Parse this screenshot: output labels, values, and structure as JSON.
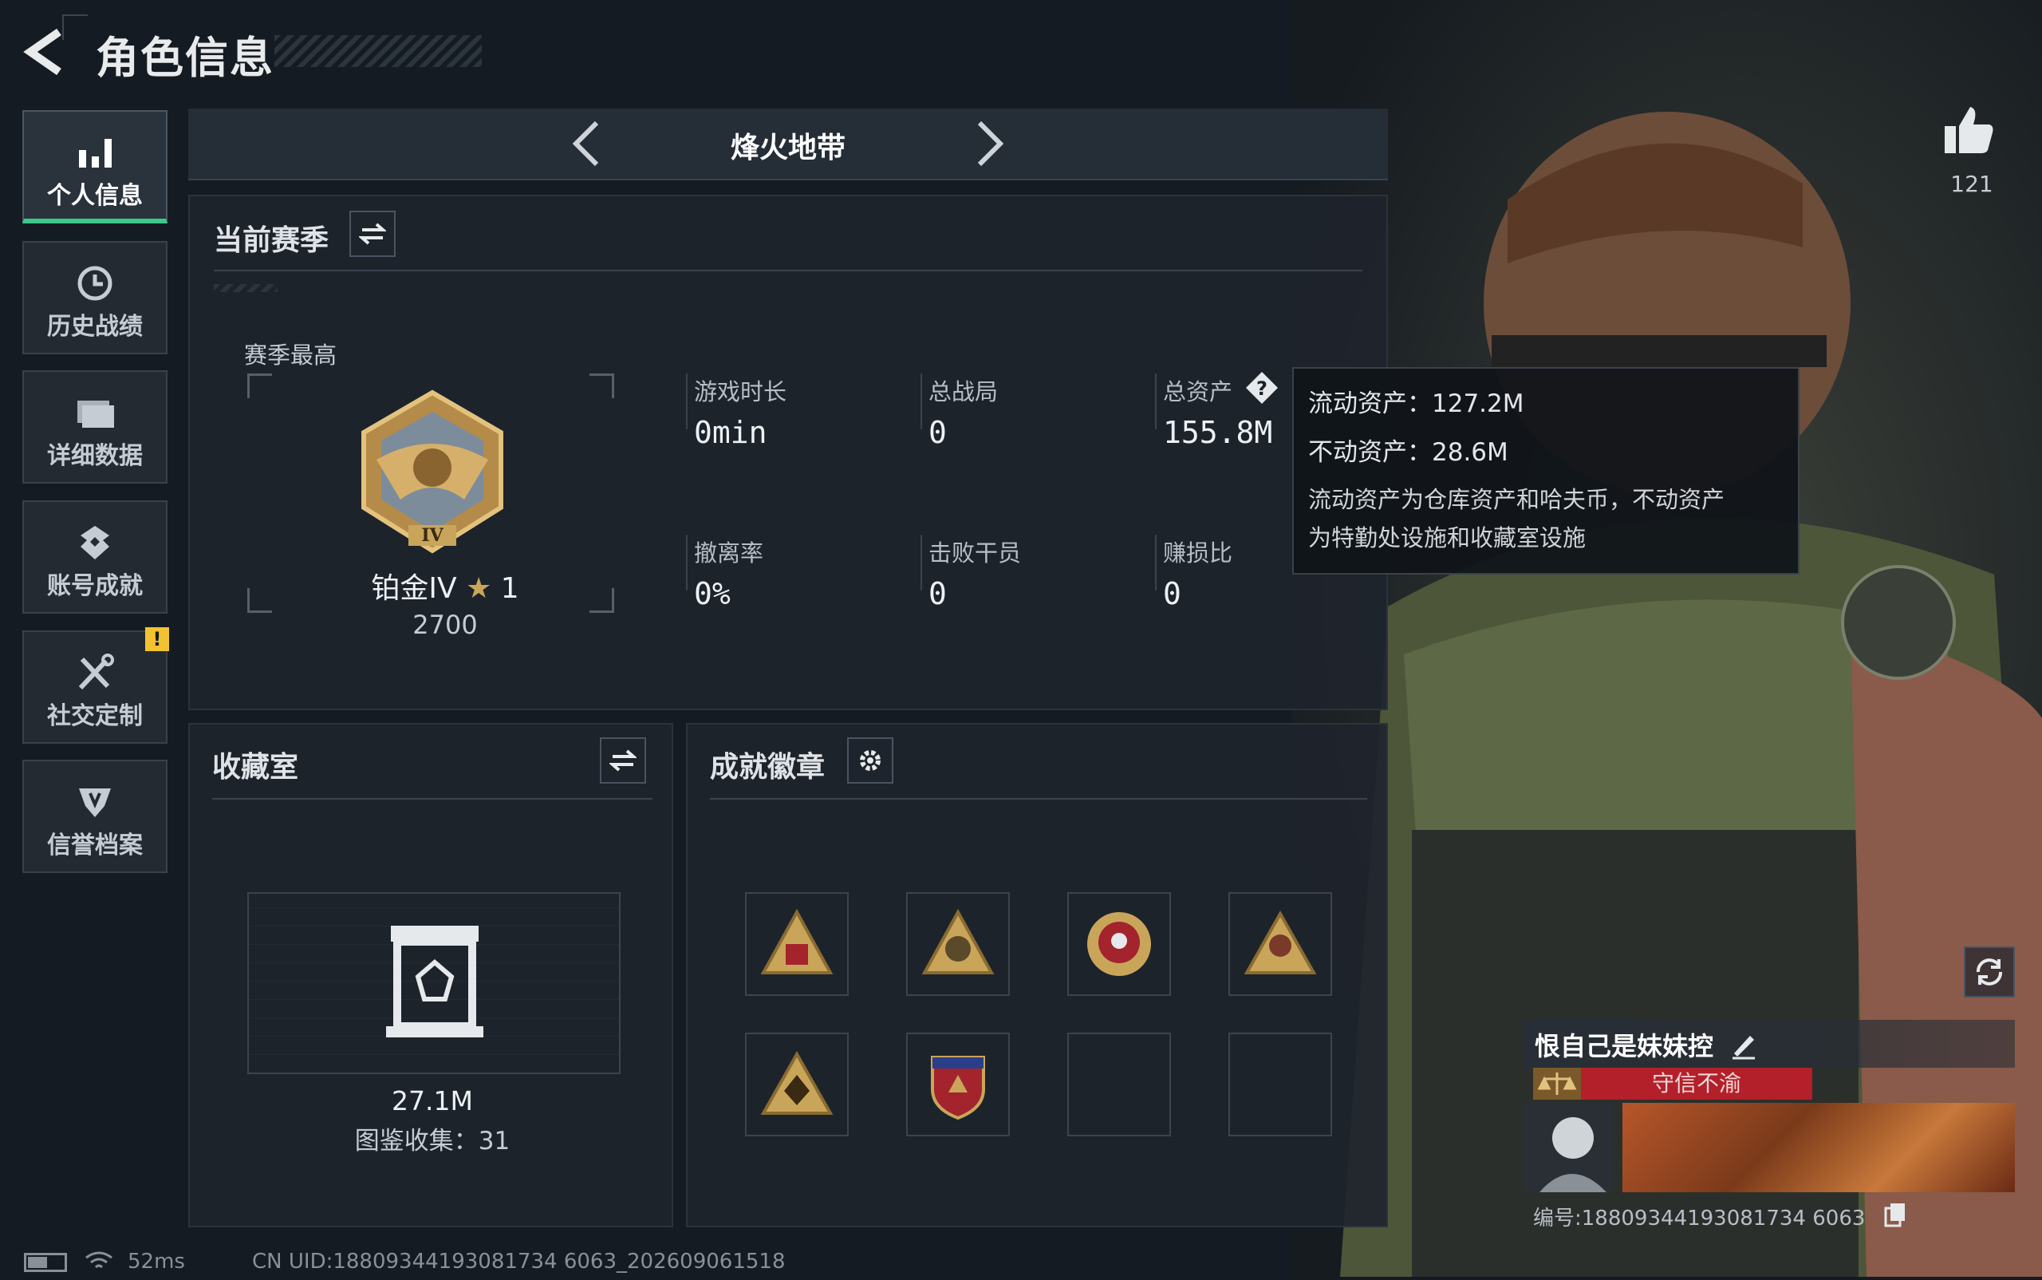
{
  "header": {
    "title": "角色信息"
  },
  "sidebar": {
    "items": [
      {
        "label": "个人信息",
        "icon": "bar-chart-icon",
        "active": true
      },
      {
        "label": "历史战绩",
        "icon": "history-icon"
      },
      {
        "label": "详细数据",
        "icon": "folder-icon"
      },
      {
        "label": "账号成就",
        "icon": "achievement-icon"
      },
      {
        "label": "社交定制",
        "icon": "tools-icon",
        "alert": "!"
      },
      {
        "label": "信誉档案",
        "icon": "shield-icon"
      }
    ]
  },
  "map_selector": {
    "name": "烽火地带"
  },
  "season": {
    "title": "当前赛季",
    "best_label": "赛季最高",
    "rank_name": "铂金IV",
    "rank_stars": "1",
    "rank_points": "2700",
    "rank_numeral": "IV",
    "stats": [
      {
        "label": "游戏时长",
        "value": "0min"
      },
      {
        "label": "总战局",
        "value": "0"
      },
      {
        "label": "总资产",
        "value": "155.8M",
        "help": "?"
      },
      {
        "label": "撤离率",
        "value": "0%"
      },
      {
        "label": "击败干员",
        "value": "0"
      },
      {
        "label": "赚损比",
        "value": "0"
      }
    ]
  },
  "tooltip": {
    "liquid": "流动资产：127.2M",
    "fixed": "不动资产：28.6M",
    "desc_line1": "流动资产为仓库资产和哈夫币，不动资产",
    "desc_line2": "为特勤处设施和收藏室设施"
  },
  "collection": {
    "title": "收藏室",
    "value": "27.1M",
    "catalog": "图鉴收集：31"
  },
  "badges": {
    "title": "成就徽章",
    "filled_count": 6,
    "slots": 8
  },
  "profile": {
    "likes": "121",
    "player_name": "恨自己是妹妹控",
    "tag": "守信不渝",
    "player_id": "编号:18809344193081734 6063"
  },
  "status_bar": {
    "ping": "52ms",
    "uid": "CN UID:18809344193081734 6063_202609061518"
  },
  "colors": {
    "accent_green": "#3ec78a",
    "tag_red": "#b3202a",
    "gold": "#c9a55a"
  }
}
